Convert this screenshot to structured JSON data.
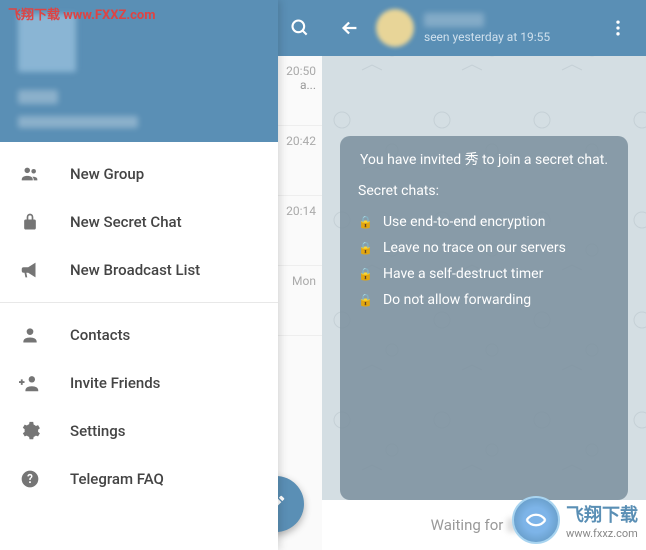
{
  "watermark": {
    "topLeft": "飞翔下载 www.FXXZ.com",
    "brand": "飞翔下载",
    "url": "www.fxxz.com"
  },
  "drawer": {
    "menu": {
      "newGroup": "New Group",
      "newSecretChat": "New Secret Chat",
      "newBroadcast": "New Broadcast List",
      "contacts": "Contacts",
      "inviteFriends": "Invite Friends",
      "settings": "Settings",
      "faq": "Telegram FAQ"
    }
  },
  "peek": {
    "rows": [
      {
        "time": "20:50",
        "preview": "a..."
      },
      {
        "time": "20:42",
        "preview": ""
      },
      {
        "time": "20:14",
        "preview": ""
      },
      {
        "time": "Mon",
        "preview": ""
      }
    ]
  },
  "chat": {
    "status": "seen yesterday at 19:55",
    "inviteLine": "You have invited 秀 to join a secret chat.",
    "secretTitle": "Secret chats:",
    "features": {
      "f1": "Use end-to-end encryption",
      "f2": "Leave no trace on our servers",
      "f3": "Have a self-destruct timer",
      "f4": "Do not allow forwarding"
    },
    "inputPlaceholder": "Waiting for"
  }
}
